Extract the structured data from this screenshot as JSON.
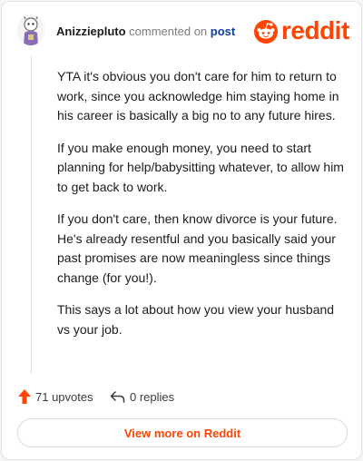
{
  "header": {
    "username": "Anizziepluto",
    "action_text": "commented on",
    "target_link": "post",
    "brand": "reddit"
  },
  "comment": {
    "paragraphs": [
      "YTA it's obvious you don't care for him to return to work, since you acknowledge him staying home in his career is basically a big no to any future hires.",
      "If you make enough money, you need to start planning for help/babysitting whatever, to allow him to get back to work.",
      "If you don't care, then know divorce is your future. He's already resentful and you basically said your past promises are now meaningless since things change (for you!).",
      "This says a lot about how you view your husband vs your job."
    ]
  },
  "actions": {
    "upvotes_label": "71 upvotes",
    "replies_label": "0 replies"
  },
  "footer": {
    "view_more_label": "View more on Reddit"
  },
  "colors": {
    "brand": "#ff4500",
    "link": "#0a3ea8",
    "text": "#1c1c1c",
    "muted": "#7c7c7c"
  },
  "icons": [
    "avatar",
    "reddit-logo-icon",
    "upvote-arrow-icon",
    "reply-icon"
  ]
}
